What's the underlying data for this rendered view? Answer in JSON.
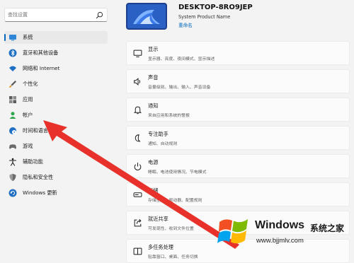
{
  "sidebar": {
    "search": {
      "placeholder": "查找设置"
    },
    "items": [
      {
        "label": "系统",
        "icon": "monitor-icon",
        "selected": true
      },
      {
        "label": "蓝牙和其他设备",
        "icon": "bluetooth-icon"
      },
      {
        "label": "网络和 Internet",
        "icon": "wifi-icon"
      },
      {
        "label": "个性化",
        "icon": "brush-icon"
      },
      {
        "label": "应用",
        "icon": "apps-icon"
      },
      {
        "label": "帐户",
        "icon": "person-icon"
      },
      {
        "label": "时间和语言",
        "icon": "globe-clock-icon"
      },
      {
        "label": "游戏",
        "icon": "gamepad-icon"
      },
      {
        "label": "辅助功能",
        "icon": "accessibility-icon"
      },
      {
        "label": "隐私和安全性",
        "icon": "shield-icon"
      },
      {
        "label": "Windows 更新",
        "icon": "update-icon"
      }
    ]
  },
  "header": {
    "device_name": "DESKTOP-8RO9JEP",
    "model": "System Product Name",
    "rename": "重命名"
  },
  "settings": [
    {
      "title": "显示",
      "desc": "显示器、亮度、夜间模式、显示描述",
      "icon": "display-icon"
    },
    {
      "title": "声音",
      "desc": "音量级别、输出、输入、声音设备",
      "icon": "speaker-icon"
    },
    {
      "title": "通知",
      "desc": "来自应用和系统的警报",
      "icon": "bell-icon"
    },
    {
      "title": "专注助手",
      "desc": "通知、自动规则",
      "icon": "moon-icon"
    },
    {
      "title": "电源",
      "desc": "睡眠、电池使用情况、节电模式",
      "icon": "power-icon"
    },
    {
      "title": "存储",
      "desc": "存储空间、驱动器、配置规则",
      "icon": "storage-icon"
    },
    {
      "title": "就近共享",
      "desc": "可发现性、收到文件位置",
      "icon": "share-icon"
    },
    {
      "title": "多任务处理",
      "desc": "贴靠窗口、桌面、任务切换",
      "icon": "multitask-icon"
    }
  ],
  "watermark": {
    "brand": "Windows",
    "suffix": "系统之家",
    "url": "www.bjjmlv.com"
  },
  "colors": {
    "accent": "#0067c0",
    "arrow": "#e8312a",
    "background": "#f3f3f3"
  }
}
